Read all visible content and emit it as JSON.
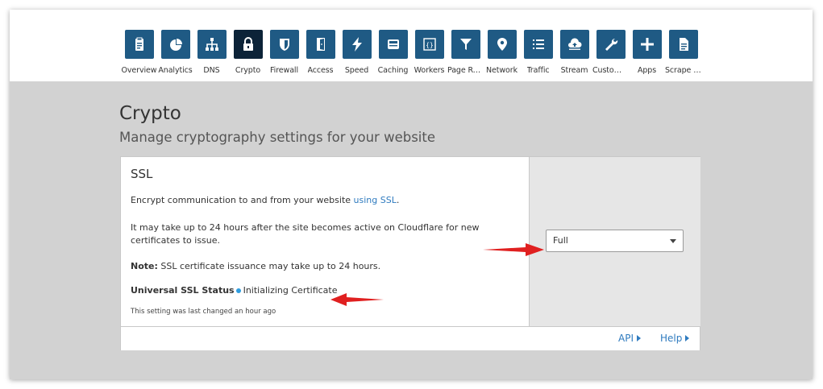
{
  "nav": [
    {
      "label": "Overview",
      "icon": "clipboard-icon"
    },
    {
      "label": "Analytics",
      "icon": "pie-chart-icon"
    },
    {
      "label": "DNS",
      "icon": "network-tree-icon"
    },
    {
      "label": "Crypto",
      "icon": "lock-icon",
      "active": true
    },
    {
      "label": "Firewall",
      "icon": "shield-icon"
    },
    {
      "label": "Access",
      "icon": "door-icon"
    },
    {
      "label": "Speed",
      "icon": "lightning-icon"
    },
    {
      "label": "Caching",
      "icon": "drive-icon"
    },
    {
      "label": "Workers",
      "icon": "braces-icon"
    },
    {
      "label": "Page Rules",
      "icon": "filter-icon"
    },
    {
      "label": "Network",
      "icon": "location-pin-icon"
    },
    {
      "label": "Traffic",
      "icon": "list-icon"
    },
    {
      "label": "Stream",
      "icon": "cloud-upload-icon"
    },
    {
      "label": "Custom ...",
      "icon": "wrench-icon"
    },
    {
      "label": "Apps",
      "icon": "plus-icon"
    },
    {
      "label": "Scrape S...",
      "icon": "document-icon"
    }
  ],
  "page": {
    "title": "Crypto",
    "subtitle": "Manage cryptography settings for your website"
  },
  "ssl": {
    "title": "SSL",
    "line1_prefix": "Encrypt communication to and from your website ",
    "line1_link": "using SSL",
    "line1_suffix": ".",
    "line2": "It may take up to 24 hours after the site becomes active on Cloudflare for new certificates to issue.",
    "note_label": "Note:",
    "note_text": " SSL certificate issuance may take up to 24 hours.",
    "status_label": "Universal SSL Status",
    "status_value": "Initializing Certificate",
    "last_changed": "This setting was last changed an hour ago",
    "mode_value": "Full"
  },
  "footer": {
    "api_label": "API",
    "help_label": "Help"
  },
  "colors": {
    "nav_tile": "#1f5a84",
    "nav_tile_active": "#0c2338",
    "link": "#2f7bbf",
    "status_dot": "#2f9de0",
    "annotation_arrow": "#e02020"
  }
}
